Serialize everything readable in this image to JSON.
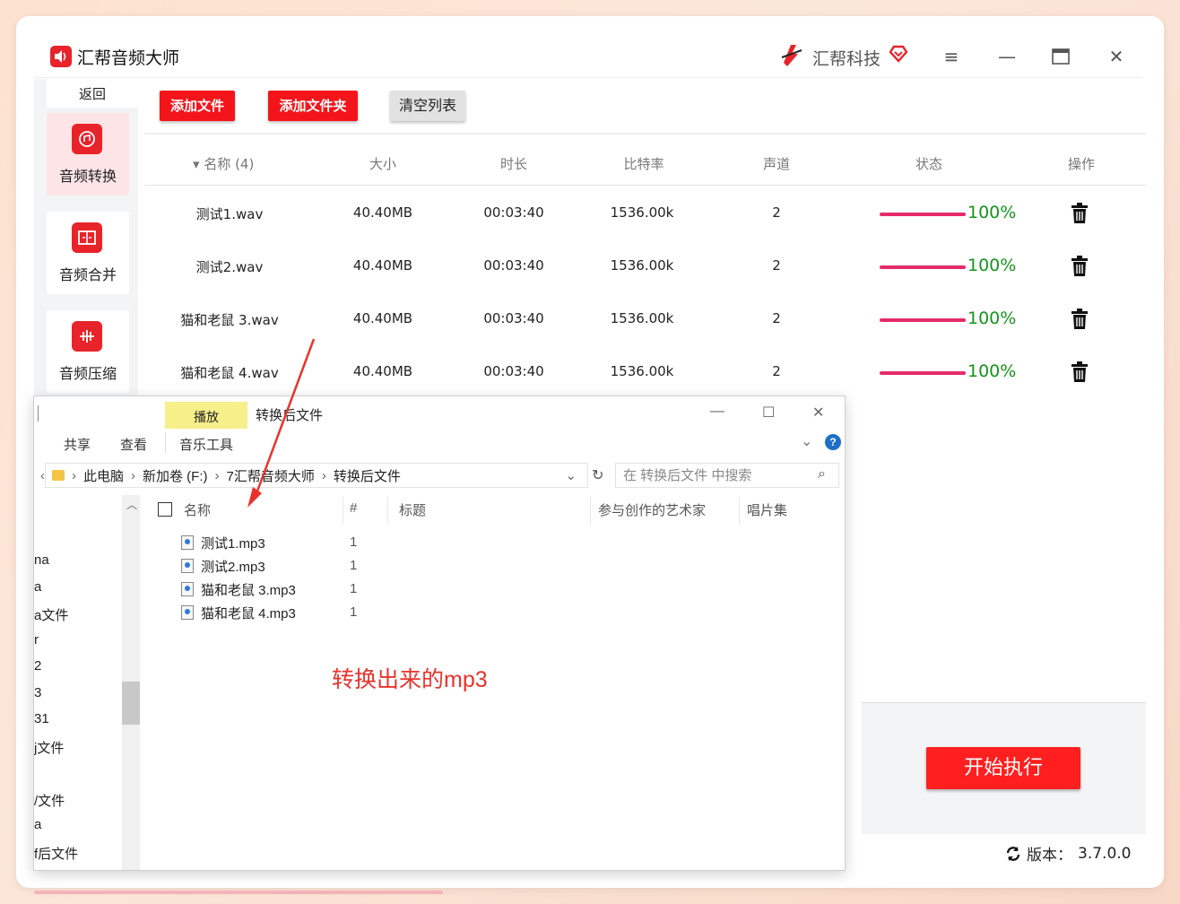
{
  "app": {
    "title": "汇帮音频大师",
    "brand": "汇帮科技",
    "accent_color": "#f3151a"
  },
  "window_controls": {
    "menu_icon": "menu-icon",
    "minimize_icon": "minimize-icon",
    "maximize_icon": "maximize-icon",
    "close_icon": "close-icon"
  },
  "sidebar": {
    "back_label": "返回",
    "items": [
      {
        "label": "音频转换",
        "icon": "audio-convert-icon",
        "active": true
      },
      {
        "label": "音频合并",
        "icon": "audio-merge-icon",
        "active": false
      },
      {
        "label": "音频压缩",
        "icon": "audio-compress-icon",
        "active": false
      }
    ]
  },
  "toolbar": {
    "add_file": "添加文件",
    "add_folder": "添加文件夹",
    "clear_list": "清空列表"
  },
  "table": {
    "columns": [
      "名称 (4)",
      "大小",
      "时长",
      "比特率",
      "声道",
      "状态",
      "操作"
    ],
    "sort_indicator": "▾",
    "rows": [
      {
        "name": "测试1.wav",
        "size": "40.40MB",
        "duration": "00:03:40",
        "bitrate": "1536.00k",
        "channels": "2",
        "progress": "100%"
      },
      {
        "name": "测试2.wav",
        "size": "40.40MB",
        "duration": "00:03:40",
        "bitrate": "1536.00k",
        "channels": "2",
        "progress": "100%"
      },
      {
        "name": "猫和老鼠 3.wav",
        "size": "40.40MB",
        "duration": "00:03:40",
        "bitrate": "1536.00k",
        "channels": "2",
        "progress": "100%"
      },
      {
        "name": "猫和老鼠 4.wav",
        "size": "40.40MB",
        "duration": "00:03:40",
        "bitrate": "1536.00k",
        "channels": "2",
        "progress": "100%"
      }
    ]
  },
  "start_button": "开始执行",
  "version": {
    "label": "版本：",
    "value": "3.7.0.0"
  },
  "explorer": {
    "play_tab": "播放",
    "title": "转换后文件",
    "ribbon": [
      "共享",
      "查看",
      "音乐工具"
    ],
    "address": [
      "此电脑",
      "新加卷 (F:)",
      "7汇帮音频大师",
      "转换后文件"
    ],
    "search_placeholder": "在 转换后文件 中搜索",
    "nav_items": [
      "na",
      "a",
      "a文件",
      "r",
      "2",
      "3",
      "31",
      "j文件",
      "",
      "/文件",
      "a",
      "f后文件"
    ],
    "columns": [
      "名称",
      "#",
      "标题",
      "参与创作的艺术家",
      "唱片集"
    ],
    "files": [
      {
        "name": "测试1.mp3",
        "num": "1"
      },
      {
        "name": "测试2.mp3",
        "num": "1"
      },
      {
        "name": "猫和老鼠 3.mp3",
        "num": "1"
      },
      {
        "name": "猫和老鼠 4.mp3",
        "num": "1"
      }
    ]
  },
  "annotation": "转换出来的mp3"
}
